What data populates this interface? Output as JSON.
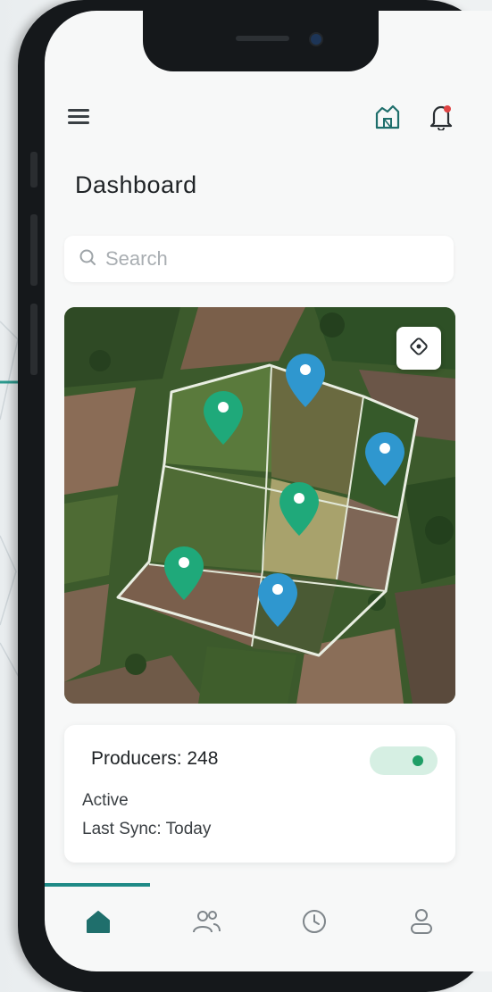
{
  "header": {
    "menu_icon": "hamburger-menu-icon",
    "actions": [
      {
        "icon": "farm-barn-icon"
      },
      {
        "icon": "bell-icon",
        "has_notification": true
      }
    ]
  },
  "page": {
    "title": "Dashboard"
  },
  "search": {
    "placeholder": "Search",
    "value": "",
    "icon": "search-icon"
  },
  "map": {
    "type": "satellite-field-map",
    "locate_button_icon": "locate-icon",
    "markers": [
      {
        "color": "#1fa97a",
        "kind": "producer"
      },
      {
        "color": "#2f97cf",
        "kind": "sensor"
      },
      {
        "color": "#2f97cf",
        "kind": "sensor"
      },
      {
        "color": "#1fa97a",
        "kind": "producer"
      },
      {
        "color": "#1fa97a",
        "kind": "producer"
      },
      {
        "color": "#2f97cf",
        "kind": "sensor"
      }
    ]
  },
  "summary": {
    "title": "Producers: 248",
    "status": "Active",
    "last_sync": "Last Sync: Today",
    "toggle_on": true
  },
  "nav": {
    "active": "home",
    "items": [
      {
        "icon": "home-icon",
        "active": true
      },
      {
        "icon": "users-icon",
        "active": false
      },
      {
        "icon": "clock-icon",
        "active": false
      },
      {
        "icon": "profile-icon",
        "active": false
      }
    ]
  },
  "colors": {
    "accent": "#1f8a86",
    "active_nav": "#1f6f6c",
    "green_marker": "#1fa97a",
    "blue_marker": "#2f97cf",
    "toggle_track": "#d6efe3",
    "toggle_knob": "#1f9e66"
  }
}
